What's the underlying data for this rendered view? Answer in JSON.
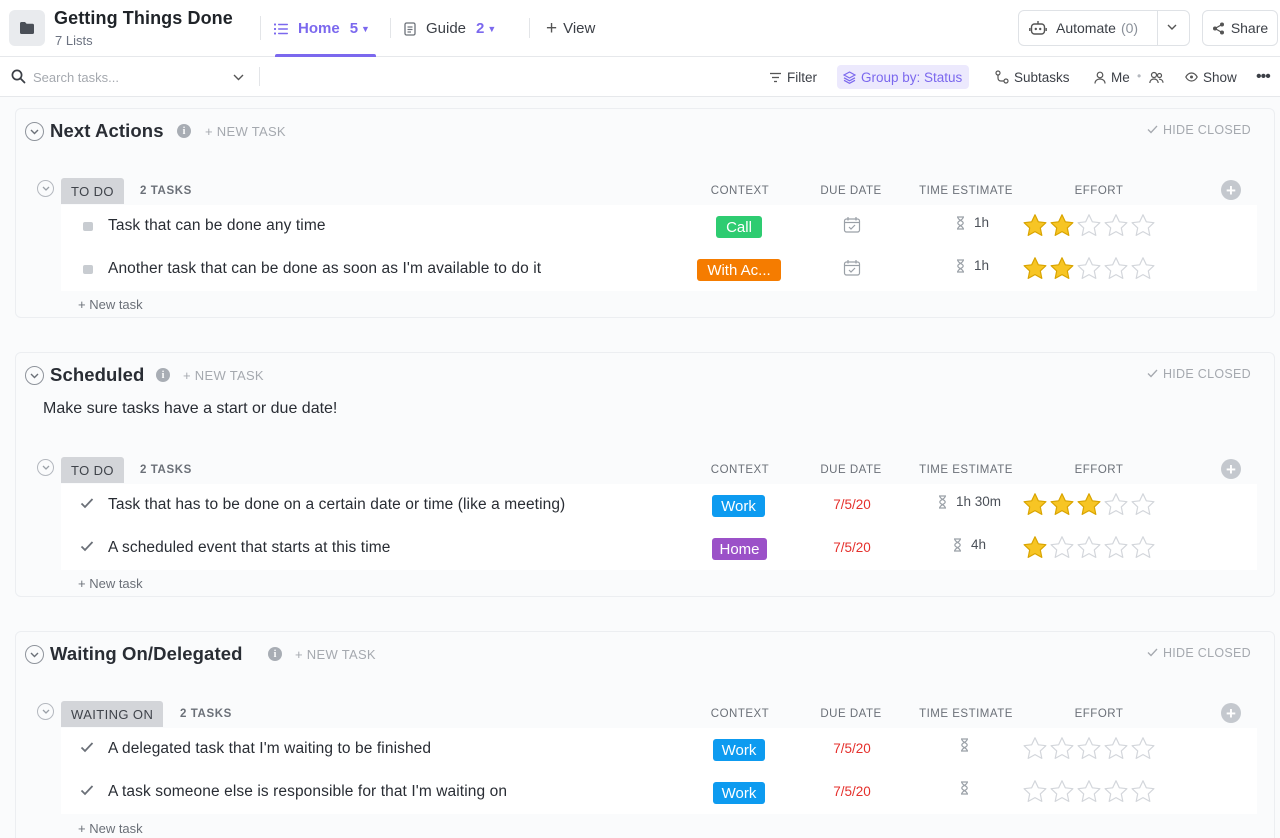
{
  "app": {
    "title": "Getting Things Done",
    "subtitle": "7 Lists"
  },
  "tabs": [
    {
      "label": "Home",
      "count": "5",
      "icon": "list-icon",
      "active": true
    },
    {
      "label": "Guide",
      "count": "2",
      "icon": "doc-icon",
      "active": false
    },
    {
      "label": "View",
      "icon": "plus-icon"
    }
  ],
  "automate": {
    "label": "Automate",
    "count": "(0)"
  },
  "share": {
    "label": "Share"
  },
  "search": {
    "placeholder": "Search tasks..."
  },
  "toolbar": {
    "filter": "Filter",
    "group_by": "Group by: Status",
    "subtasks": "Subtasks",
    "me": "Me",
    "show": "Show",
    "more": "•••"
  },
  "colors": {
    "accent": "#7b68ee",
    "call": "#2ecc71",
    "with_access": "#f57c00",
    "work": "#0d9bf0",
    "home": "#9b51c8",
    "due": "#e5302c",
    "star": "#f7c524"
  },
  "columns": {
    "context": "CONTEXT",
    "due_date": "DUE DATE",
    "time_estimate": "TIME ESTIMATE",
    "effort": "EFFORT"
  },
  "sections": [
    {
      "title": "Next Actions",
      "new_task": "+ NEW TASK",
      "hide_closed": "HIDE CLOSED",
      "description": "",
      "group": {
        "status": "TO DO",
        "task_count": "2 TASKS"
      },
      "tasks": [
        {
          "name": "Task that can be done any time",
          "marker": "bullet",
          "context": "Call",
          "context_color": "#2ecc71",
          "due": "",
          "estimate": "1h",
          "effort": 2
        },
        {
          "name": "Another task that can be done as soon as I'm available to do it",
          "marker": "bullet",
          "context": "With Ac...",
          "context_color": "#f57c00",
          "due": "",
          "estimate": "1h",
          "effort": 2
        }
      ],
      "new_task_row": "+ New task"
    },
    {
      "title": "Scheduled",
      "new_task": "+ NEW TASK",
      "hide_closed": "HIDE CLOSED",
      "description": "Make sure tasks have a start or due date!",
      "group": {
        "status": "TO DO",
        "task_count": "2 TASKS"
      },
      "tasks": [
        {
          "name": "Task that has to be done on a certain date or time (like a meeting)",
          "marker": "check",
          "context": "Work",
          "context_color": "#0d9bf0",
          "due": "7/5/20",
          "estimate": "1h 30m",
          "effort": 3
        },
        {
          "name": "A scheduled event that starts at this time",
          "marker": "check",
          "context": "Home",
          "context_color": "#9b51c8",
          "due": "7/5/20",
          "estimate": "4h",
          "effort": 1
        }
      ],
      "new_task_row": "+ New task"
    },
    {
      "title": "Waiting On/Delegated",
      "new_task": "+ NEW TASK",
      "hide_closed": "HIDE CLOSED",
      "description": "",
      "group": {
        "status": "WAITING ON",
        "task_count": "2 TASKS"
      },
      "tasks": [
        {
          "name": "A delegated task that I'm waiting to be finished",
          "marker": "check",
          "context": "Work",
          "context_color": "#0d9bf0",
          "due": "7/5/20",
          "estimate": "",
          "effort": 0
        },
        {
          "name": "A task someone else is responsible for that I'm waiting on",
          "marker": "check",
          "context": "Work",
          "context_color": "#0d9bf0",
          "due": "7/5/20",
          "estimate": "",
          "effort": 0
        }
      ],
      "new_task_row": "+ New task"
    }
  ]
}
